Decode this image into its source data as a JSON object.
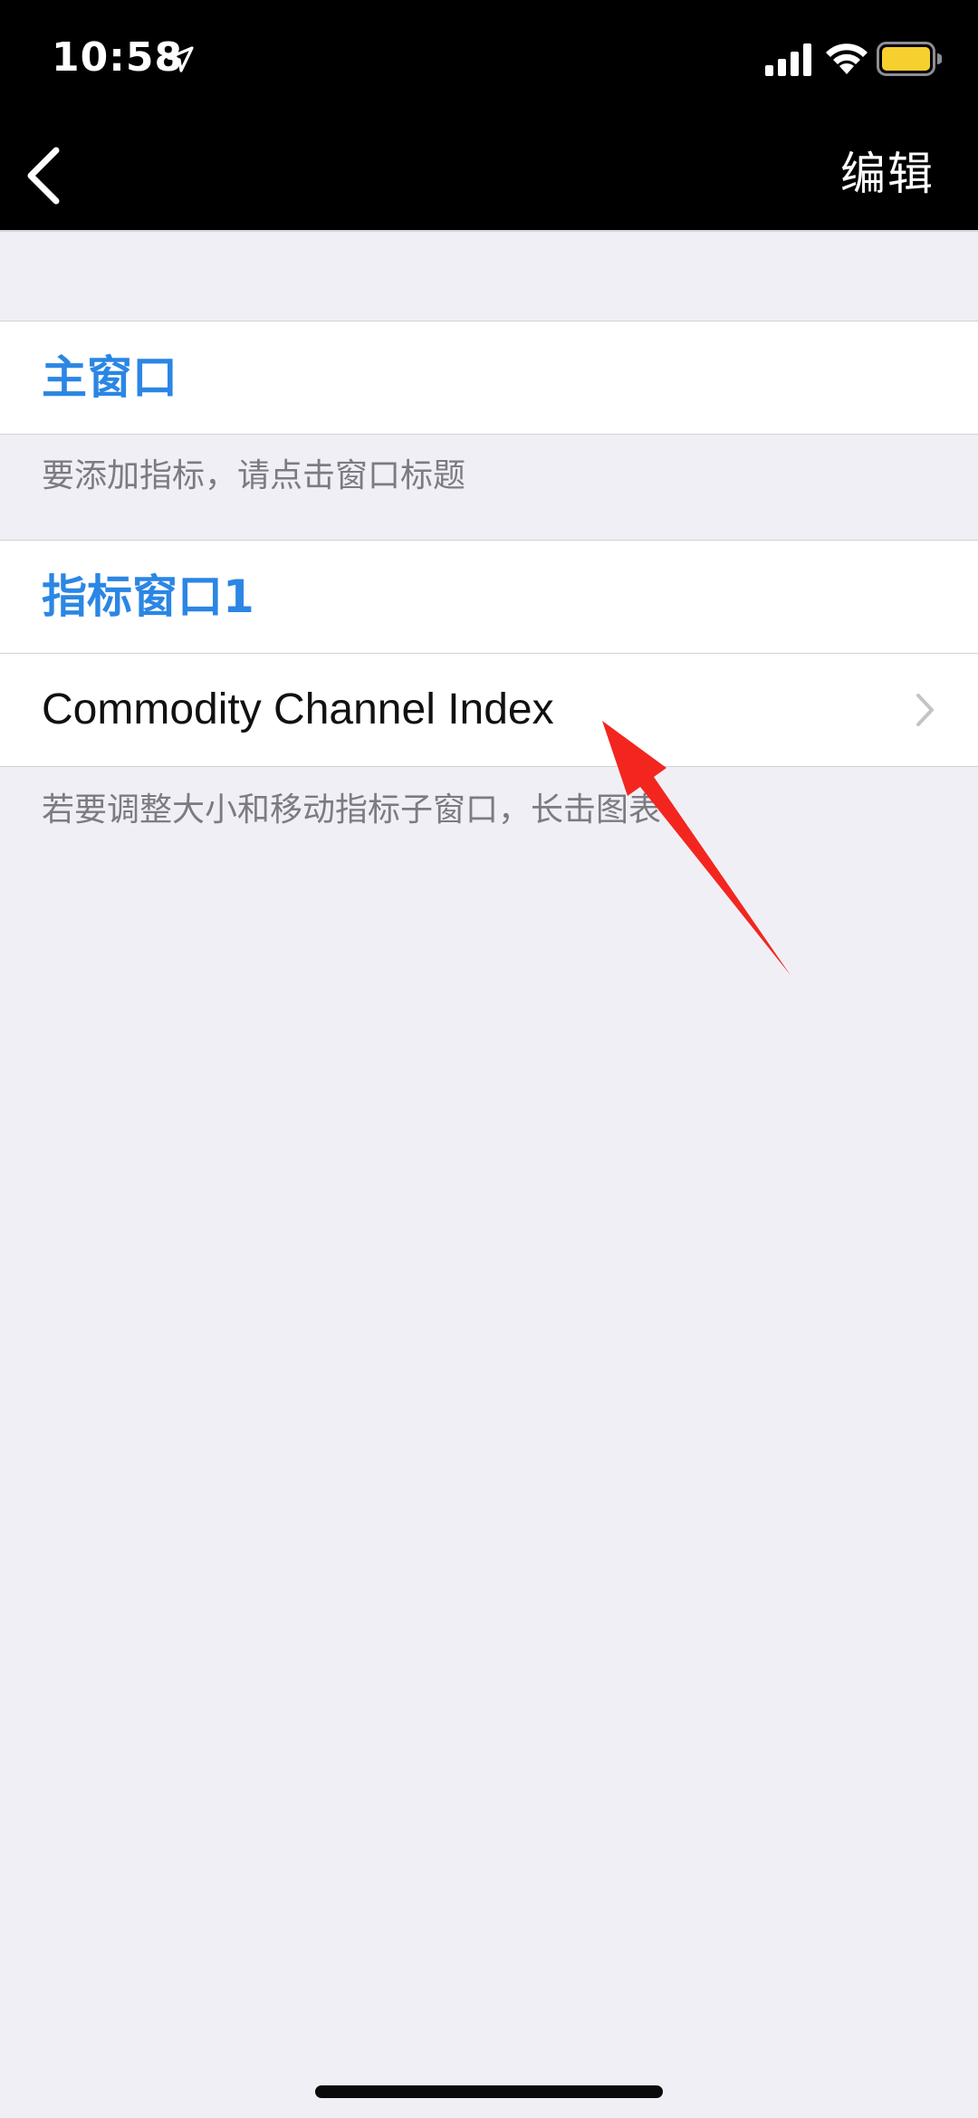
{
  "status_bar": {
    "time": "10:58",
    "icons": [
      "location-arrow-icon",
      "cellular-signal-icon",
      "wifi-icon",
      "battery-icon"
    ],
    "battery_color": "#f6d02e"
  },
  "nav": {
    "back_icon": "chevron-left-icon",
    "edit_label": "编辑"
  },
  "main_window": {
    "title": "主窗口",
    "hint": "要添加指标，请点击窗口标题"
  },
  "indicator_window": {
    "title": "指标窗口1",
    "items": [
      {
        "label": "Commodity Channel Index",
        "icon": "chevron-right-icon"
      }
    ],
    "hint": "若要调整大小和移动指标子窗口，长击图表"
  },
  "colors": {
    "accent": "#2b86e4",
    "background": "#f1eff6",
    "annotation": "#f2261f"
  }
}
